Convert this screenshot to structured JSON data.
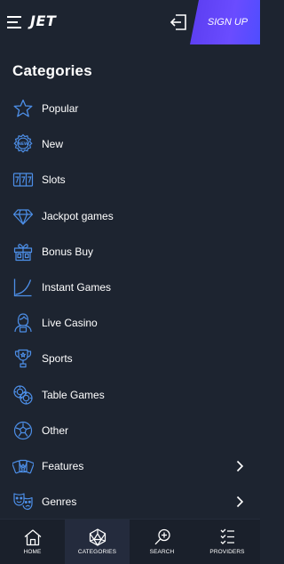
{
  "header": {
    "logo": "JET",
    "signup_label": "SIGN UP"
  },
  "title": "Categories",
  "categories": [
    {
      "label": "Popular",
      "icon": "star-icon"
    },
    {
      "label": "New",
      "icon": "new-badge-icon"
    },
    {
      "label": "Slots",
      "icon": "slots-777-icon"
    },
    {
      "label": "Jackpot games",
      "icon": "diamond-icon"
    },
    {
      "label": "Bonus Buy",
      "icon": "gift-icon"
    },
    {
      "label": "Instant Games",
      "icon": "crash-curve-icon"
    },
    {
      "label": "Live Casino",
      "icon": "dealer-icon"
    },
    {
      "label": "Sports",
      "icon": "trophy-icon"
    },
    {
      "label": "Table Games",
      "icon": "chips-icon"
    },
    {
      "label": "Other",
      "icon": "ball-icon"
    },
    {
      "label": "Features",
      "icon": "cards-icon",
      "has_children": true
    },
    {
      "label": "Genres",
      "icon": "masks-icon",
      "has_children": true
    }
  ],
  "bottom_nav": [
    {
      "label": "HOME",
      "icon": "home-icon"
    },
    {
      "label": "CATEGORIES",
      "icon": "categories-icon",
      "active": true
    },
    {
      "label": "SEARCH",
      "icon": "search-icon"
    },
    {
      "label": "PROVIDERS",
      "icon": "providers-icon"
    }
  ],
  "colors": {
    "background": "#1d2430",
    "accent": "#5b3df0",
    "icon": "#4d8fe8"
  }
}
